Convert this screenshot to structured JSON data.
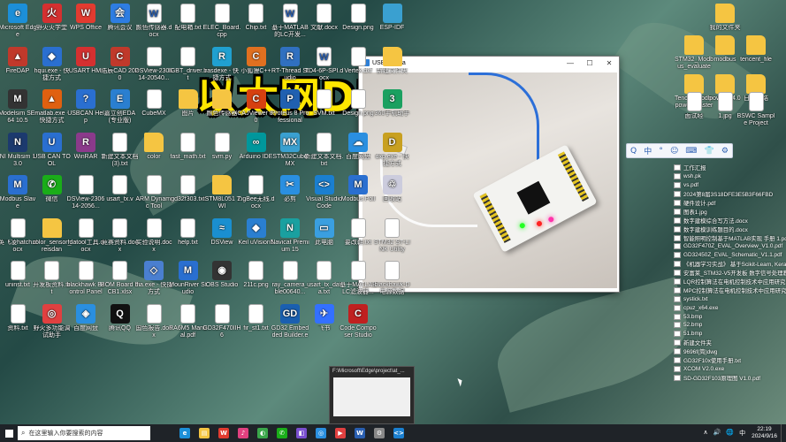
{
  "headline": "以太网DNS域名解析",
  "camera_window": {
    "title": "USBcamera",
    "minimize": "—",
    "maximize": "☐",
    "close": "✕"
  },
  "ime_toolbar": [
    "Q",
    "中",
    "°",
    "☺",
    "⌨",
    "👕",
    "⚙"
  ],
  "desktop_icons": [
    {
      "label": "Microsoft Edge",
      "glyph": "e",
      "color": "#1c8fd8"
    },
    {
      "label": "野火火学堂",
      "glyph": "火",
      "color": "#d43030"
    },
    {
      "label": "WPS Office",
      "glyph": "W",
      "color": "#e23b30"
    },
    {
      "label": "腾讯会议",
      "glyph": "会",
      "color": "#2e7de2"
    },
    {
      "label": "颜色传感器.docx",
      "glyph": "W",
      "color": "#fff"
    },
    {
      "label": "配电箱.txt",
      "glyph": "",
      "color": "#fff"
    },
    {
      "label": "ELEC_Board.cpp",
      "glyph": "",
      "color": "#fff"
    },
    {
      "label": "Chip.txt",
      "glyph": "",
      "color": "#fff"
    },
    {
      "label": "基于MATLAB的LC开发...",
      "glyph": "W",
      "color": "#fff"
    },
    {
      "label": "文献.docx",
      "glyph": "",
      "color": "#fff"
    },
    {
      "label": "Design.png",
      "glyph": "",
      "color": "#fff"
    },
    {
      "label": "ESP-IDF",
      "glyph": "",
      "color": "#3aa0d0"
    },
    {
      "label": "FireDAP",
      "glyph": "▲",
      "color": "#c0392b"
    },
    {
      "label": "hqui.exe - 快捷方式",
      "glyph": "◆",
      "color": "#2a6fd0"
    },
    {
      "label": "USART HMI",
      "glyph": "U",
      "color": "#d43030"
    },
    {
      "label": "浩辰CAD 2020",
      "glyph": "C",
      "color": "#c0392b"
    },
    {
      "label": "DSView-230614-20540...",
      "glyph": "",
      "color": "#fff"
    },
    {
      "label": "IGBT_driver.bt",
      "glyph": "",
      "color": "#fff"
    },
    {
      "label": "rasdexe - 快捷方式",
      "glyph": "R",
      "color": "#20a0d0"
    },
    {
      "label": "小狐狸C++",
      "glyph": "C",
      "color": "#e07020"
    },
    {
      "label": "RT-Thread Studio",
      "glyph": "R",
      "color": "#3070c0"
    },
    {
      "label": "TD4-6P-SPI.docx",
      "glyph": "W",
      "color": "#fff"
    },
    {
      "label": "Vertex.dxf",
      "glyph": "",
      "color": "#fff"
    },
    {
      "label": "新建文件夹",
      "glyph": "",
      "color": "#f5c542"
    },
    {
      "label": "Modelsim SE-64 10.5",
      "glyph": "M",
      "color": "#333"
    },
    {
      "label": "matlab.exe - 快捷方式",
      "glyph": "▲",
      "color": "#e06010"
    },
    {
      "label": "USBCAN Help",
      "glyph": "?",
      "color": "#2a6fd0"
    },
    {
      "label": "嘉立创EDA(专业版)",
      "glyph": "E",
      "color": "#2a7fd0"
    },
    {
      "label": "CubeMX",
      "glyph": "",
      "color": "#fff"
    },
    {
      "label": "图片",
      "glyph": "",
      "color": "#f5c542"
    },
    {
      "label": "颜色传感器",
      "glyph": "",
      "color": "#f5c542"
    },
    {
      "label": "CAJViewer 8.0",
      "glyph": "C",
      "color": "#d64010"
    },
    {
      "label": "Proteus 8 Professional",
      "glyph": "P",
      "color": "#2060b0"
    },
    {
      "label": "SVM.txt",
      "glyph": "",
      "color": "#fff"
    },
    {
      "label": "Design.png",
      "glyph": "",
      "color": "#fff"
    },
    {
      "label": "360手机助手",
      "glyph": "3",
      "color": "#1aa060"
    },
    {
      "label": "NI Multisim 13.0",
      "glyph": "N",
      "color": "#1c3a6e"
    },
    {
      "label": "USB CAN TOOL",
      "glyph": "U",
      "color": "#2a6fd0"
    },
    {
      "label": "WinRAR",
      "glyph": "R",
      "color": "#8b3a8b"
    },
    {
      "label": "新建文本文档(3).txt",
      "glyph": "",
      "color": "#fff"
    },
    {
      "label": "color",
      "glyph": "",
      "color": "#f5c542"
    },
    {
      "label": "fast_math.txt",
      "glyph": "",
      "color": "#fff"
    },
    {
      "label": "svm.py",
      "glyph": "",
      "color": "#fff"
    },
    {
      "label": "Arduino IDE",
      "glyph": "∞",
      "color": "#00979c"
    },
    {
      "label": "STM32CubeMX",
      "glyph": "MX",
      "color": "#3aa0d0"
    },
    {
      "label": "新建文本文档.txt",
      "glyph": "",
      "color": "#fff"
    },
    {
      "label": "百度网盘",
      "glyph": "☁",
      "color": "#2a8fe0"
    },
    {
      "label": "dxp.exe - 快捷方式",
      "glyph": "D",
      "color": "#c8a020"
    },
    {
      "label": "Modbus Slave",
      "glyph": "M",
      "color": "#2a6fd0"
    },
    {
      "label": "微信",
      "glyph": "✆",
      "color": "#1aad19"
    },
    {
      "label": "DSView-230614-2056...",
      "glyph": "",
      "color": "#fff"
    },
    {
      "label": "usart_tx.v",
      "glyph": "",
      "color": "#fff"
    },
    {
      "label": "ARM Dynamic Tool",
      "glyph": "",
      "color": "#fff"
    },
    {
      "label": "gd32f303.txt",
      "glyph": "",
      "color": "#fff"
    },
    {
      "label": "iSTM8L051 TWI",
      "glyph": "",
      "color": "#f5c542"
    },
    {
      "label": "ZigBee无线.docx",
      "glyph": "",
      "color": "#fff"
    },
    {
      "label": "必剪",
      "glyph": "✂",
      "color": "#2a8fe0"
    },
    {
      "label": "Visual Studio Code",
      "glyph": "<>",
      "color": "#1a7fd0"
    },
    {
      "label": "Modbus Poll",
      "glyph": "M",
      "color": "#2a6fd0"
    },
    {
      "label": "回收站",
      "glyph": "♲",
      "color": "#ccd"
    },
    {
      "label": "英飞凌hatch.docx",
      "glyph": "",
      "color": "#fff"
    },
    {
      "label": "color_sensor_reisdan",
      "glyph": "",
      "color": "#f5c542"
    },
    {
      "label": "fdatool工具.docx",
      "glyph": "",
      "color": "#fff"
    },
    {
      "label": "竞赛资料.docx",
      "glyph": "",
      "color": "#fff"
    },
    {
      "label": "实验说明.docx",
      "glyph": "",
      "color": "#fff"
    },
    {
      "label": "help.txt",
      "glyph": "",
      "color": "#fff"
    },
    {
      "label": "DSView",
      "glyph": "≈",
      "color": "#1a8fd0"
    },
    {
      "label": "Keil uVision5",
      "glyph": "◆",
      "color": "#2a7fd0"
    },
    {
      "label": "Navicat Premium 15",
      "glyph": "N",
      "color": "#1aa0a0"
    },
    {
      "label": "此电脑",
      "glyph": "▭",
      "color": "#3a9fe0"
    },
    {
      "label": "要改鞋.txt",
      "glyph": "",
      "color": "#fff"
    },
    {
      "label": "STM32 ST-LINK Utility",
      "glyph": "",
      "color": "#fff"
    },
    {
      "label": "uninst.txt",
      "glyph": "",
      "color": "#fff"
    },
    {
      "label": "开发板资料.txt",
      "glyph": "",
      "color": "#fff"
    },
    {
      "label": "blackhawk Bcontrol Panel",
      "glyph": "",
      "color": "#fff"
    },
    {
      "label": "BOM Board PCB1.xlsx",
      "glyph": "",
      "color": "#fff"
    },
    {
      "label": "dia.exe - 快捷方式",
      "glyph": "◇",
      "color": "#4a7fd0"
    },
    {
      "label": "MounRiver Studio",
      "glyph": "M",
      "color": "#2a6fd0"
    },
    {
      "label": "OBS Studio",
      "glyph": "◉",
      "color": "#333"
    },
    {
      "label": "211c.png",
      "glyph": "",
      "color": "#fff"
    },
    {
      "label": "ray_camera_ble00640...",
      "glyph": "",
      "color": "#fff"
    },
    {
      "label": "usart_tx_data.txt",
      "glyph": "",
      "color": "#fff"
    },
    {
      "label": "基于MATLAB LC滤波器...",
      "glyph": "",
      "color": "#fff"
    },
    {
      "label": "blackhawk-D电源数据",
      "glyph": "",
      "color": "#fff"
    },
    {
      "label": "资料.txt",
      "glyph": "",
      "color": "#fff"
    },
    {
      "label": "野火多功能调试助手",
      "glyph": "◎",
      "color": "#e04040"
    },
    {
      "label": "百度网盘",
      "glyph": "◈",
      "color": "#2a8fe0"
    },
    {
      "label": "腾讯QQ",
      "glyph": "Q",
      "color": "#111"
    },
    {
      "label": "国色报告.docx",
      "glyph": "",
      "color": "#fff"
    },
    {
      "label": "RA6M5 Manual.pdf",
      "glyph": "",
      "color": "#fff"
    },
    {
      "label": "GD32F470IIH6",
      "glyph": "",
      "color": "#fff"
    },
    {
      "label": "fir_st1.txt",
      "glyph": "",
      "color": "#fff"
    },
    {
      "label": "GD32 Embedded Builder.exe",
      "glyph": "GD",
      "color": "#1a5fb0"
    },
    {
      "label": "飞书",
      "glyph": "✈",
      "color": "#3370ff"
    },
    {
      "label": "Code Composer Studio",
      "glyph": "C",
      "color": "#c02020"
    }
  ],
  "right_top_icons": [
    {
      "label": "我的文件夹",
      "glyph": "",
      "color": "#f5c542"
    },
    {
      "label": "STM32_Modbus_evaluate",
      "glyph": "",
      "color": "#f5c542"
    },
    {
      "label": "modbus",
      "glyph": "",
      "color": "#f5c542"
    },
    {
      "label": "tencent_file",
      "glyph": "",
      "color": "#f5c542"
    },
    {
      "label": "TencentLibdb-power-master",
      "glyph": "",
      "color": "#f5c542"
    },
    {
      "label": "power V4.0",
      "glyph": "",
      "color": "#f5c542"
    },
    {
      "label": "日志总结",
      "glyph": "",
      "color": "#f5c542"
    },
    {
      "label": "面试经",
      "glyph": "",
      "color": "#fff"
    },
    {
      "label": "1.jpg",
      "glyph": "",
      "color": "#fff"
    },
    {
      "label": "BSWC Sample Project",
      "glyph": "",
      "color": "#fff"
    }
  ],
  "right_file_list": [
    "工作汇报",
    "wsh.pk",
    "vs.pdf",
    "2024第8届3S18DFE3E5B3F66FBD",
    "硬件设计.pdf",
    "图表1.jpg",
    "数字建模综合写方法.docx",
    "数字建模训练题目的.docx",
    "智能照明控制基于MATLAB实现 手册 1.pdf",
    "GD32F470Z_EVAL_Overview_V1.0.pdf",
    "GD32450Z_EVAL_Schematic_V1.1.pdf",
    "《机器学习实战》 基于Scikit-Learn, Keras和...",
    "安富莱_STM32-V5开发板 数字信号处理教程...",
    "LQR控制算法在电机控制技术中应用研究.pdf",
    "MPC控制算法在电机控制技术中应用研究.pdf",
    "systick.txt",
    "cpuz_x64.exe",
    "53.bmp",
    "52.bmp",
    "51.bmp",
    "新建文件夹",
    "9696f(简)dwg",
    "GD32F10x使用手册.txt",
    "XCOM V2.0.exe",
    "SD-GD32F103原理图 V1.0.pdf"
  ],
  "thumbnail": {
    "title": "F:\\Microsoft\\Edge\\project\\at_..."
  },
  "taskbar": {
    "search_placeholder": "在这里输入你要搜索的内容",
    "apps": [
      {
        "name": "edge",
        "glyph": "e",
        "color": "#1c8fd8"
      },
      {
        "name": "file-explorer",
        "glyph": "▤",
        "color": "#f5c542"
      },
      {
        "name": "wps",
        "glyph": "W",
        "color": "#e23b30"
      },
      {
        "name": "music",
        "glyph": "♪",
        "color": "#e0407f"
      },
      {
        "name": "chrome",
        "glyph": "◐",
        "color": "#3aa64a"
      },
      {
        "name": "wechat",
        "glyph": "✆",
        "color": "#1aad19"
      },
      {
        "name": "apps",
        "glyph": "◧",
        "color": "#7a4fd0"
      },
      {
        "name": "browser",
        "glyph": "◎",
        "color": "#2a8fe0"
      },
      {
        "name": "camera",
        "glyph": "▶",
        "color": "#e04040"
      },
      {
        "name": "word",
        "glyph": "W",
        "color": "#2a5fb0"
      },
      {
        "name": "settings",
        "glyph": "⚙",
        "color": "#888"
      },
      {
        "name": "vscode",
        "glyph": "<>",
        "color": "#1a7fd0"
      }
    ],
    "tray": {
      "icons": [
        "∧",
        "🔊",
        "🌐",
        "中"
      ],
      "time": "22:19",
      "date": "2024/9/16"
    }
  }
}
